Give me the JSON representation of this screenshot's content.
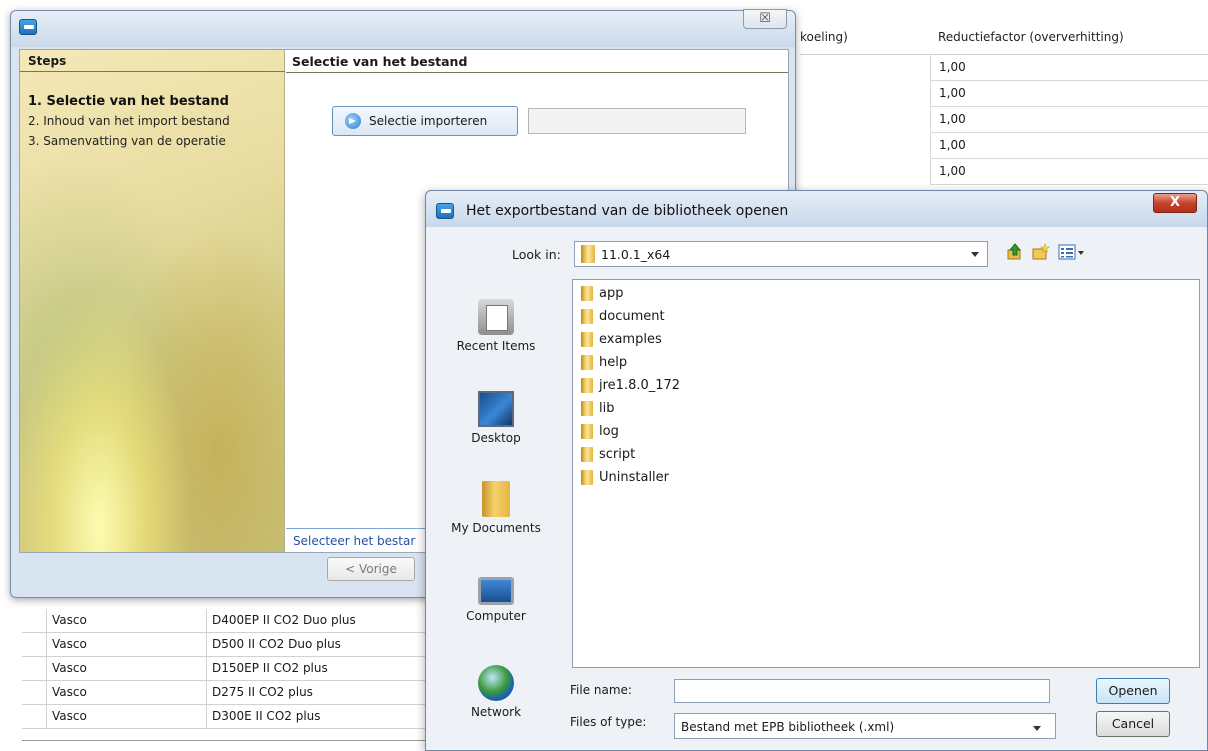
{
  "background_table": {
    "header_partial": "koeling)",
    "header_factor": "Reductiefactor (oververhitting)",
    "factor_values": [
      "1,00",
      "1,00",
      "1,00",
      "1,00",
      "1,00"
    ],
    "rows": [
      {
        "brand": "Vasco",
        "product": "D400EP II CO2 Duo plus"
      },
      {
        "brand": "Vasco",
        "product": "D500 II CO2 Duo plus"
      },
      {
        "brand": "Vasco",
        "product": "D150EP II CO2 plus"
      },
      {
        "brand": "Vasco",
        "product": "D275 II CO2 plus"
      },
      {
        "brand": "Vasco",
        "product": "D300E II CO2 plus"
      }
    ]
  },
  "wizard": {
    "close_glyph": "☒",
    "steps_title": "Steps",
    "steps": [
      "1. Selectie van het bestand",
      "2. Inhoud van het import bestand",
      "3. Samenvatting van de operatie"
    ],
    "section_title": "Selectie van het bestand",
    "import_button": "Selectie importeren",
    "status_text": "Selecteer het bestar",
    "prev_button": "< Vorige"
  },
  "dialog": {
    "title": "Het exportbestand van de bibliotheek openen",
    "close_glyph": "X",
    "look_in_label": "Look in:",
    "look_in_value": "11.0.1_x64",
    "places": [
      "Recent Items",
      "Desktop",
      "My Documents",
      "Computer",
      "Network"
    ],
    "files": [
      "app",
      "document",
      "examples",
      "help",
      "jre1.8.0_172",
      "lib",
      "log",
      "script",
      "Uninstaller"
    ],
    "file_name_label": "File name:",
    "file_name_value": "",
    "file_type_label": "Files of type:",
    "file_type_value": "Bestand met EPB bibliotheek (.xml)",
    "open_button": "Openen",
    "cancel_button": "Cancel"
  },
  "icons": {
    "app": "app-icon",
    "folder": "folder-icon",
    "up": "up-folder-icon",
    "new_folder": "new-folder-icon",
    "view_menu": "view-menu-icon",
    "import": "import-icon"
  }
}
